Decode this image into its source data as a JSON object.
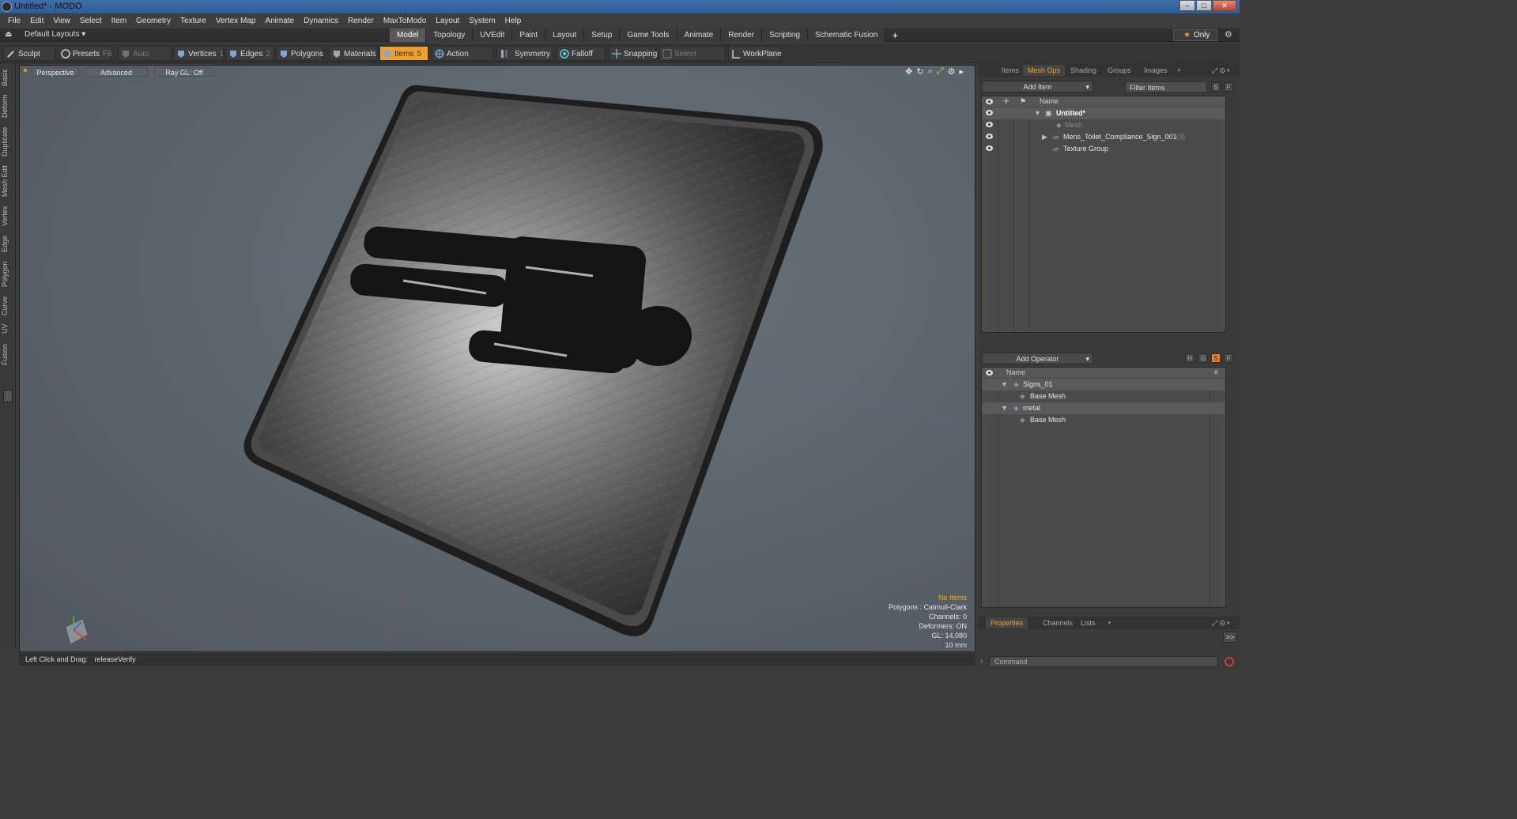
{
  "window": {
    "title": "Untitled* - MODO"
  },
  "menu": [
    "File",
    "Edit",
    "View",
    "Select",
    "Item",
    "Geometry",
    "Texture",
    "Vertex Map",
    "Animate",
    "Dynamics",
    "Render",
    "MaxToModo",
    "Layout",
    "System",
    "Help"
  ],
  "layout": {
    "selector": "Default Layouts ▾",
    "tabs": [
      "Model",
      "Topology",
      "UVEdit",
      "Paint",
      "Layout",
      "Setup",
      "Game Tools",
      "Animate",
      "Render",
      "Scripting",
      "Schematic Fusion"
    ],
    "active_tab": "Model",
    "add": "+",
    "only": "Only"
  },
  "toolbar": {
    "sculpt": "Sculpt",
    "presets": "Presets",
    "presets_key": "F6",
    "auto_select": "Auto Select",
    "vertices": "Vertices",
    "vertices_key": "1",
    "edges": "Edges",
    "edges_key": "2",
    "polygons": "Polygons",
    "materials": "Materials",
    "items": "Items",
    "items_key": "5",
    "action_center": "Action Center",
    "symmetry": "Symmetry",
    "falloff": "Falloff",
    "snapping": "Snapping",
    "select_through": "Select Through",
    "workplane": "WorkPlane"
  },
  "left_tabs": [
    "Basic",
    "Deform",
    "Duplicate",
    "Mesh Edit",
    "Vertex",
    "Edge",
    "Polygon",
    "Curve",
    "UV",
    "Fusion"
  ],
  "viewport": {
    "view": "Perspective",
    "shading": "Advanced",
    "raygl": "Ray GL: Off",
    "hud": {
      "selection": "No Items",
      "polygons": "Polygons : Catmull-Clark",
      "channels": "Channels: 0",
      "deformers": "Deformers: ON",
      "gl": "GL: 14,080",
      "unit": "10 mm"
    }
  },
  "status": {
    "hint": "Left Click and Drag:",
    "action": "releaseVerify"
  },
  "panel": {
    "tabs": [
      "Items",
      "Mesh Ops",
      "Shading",
      "Groups",
      "Images"
    ],
    "active_tab": "Mesh Ops",
    "add_item": "Add Item",
    "filter": "Filter Items",
    "sf": [
      "S",
      "F"
    ],
    "items_header": "Name",
    "items": [
      {
        "name": "Untitled*",
        "count": ""
      },
      {
        "name": "Mesh",
        "count": ""
      },
      {
        "name": "Mens_Toilet_Compliance_Sign_001",
        "count": "(3)"
      },
      {
        "name": "Texture Group",
        "count": ""
      }
    ],
    "add_operator": "Add Operator",
    "hgsf": [
      "H",
      "G",
      "S",
      "F"
    ],
    "ops_header": "Name",
    "ops_hash": "#",
    "ops": [
      {
        "name": "Signs_01"
      },
      {
        "name": "Base Mesh"
      },
      {
        "name": "metal"
      },
      {
        "name": "Base Mesh"
      }
    ],
    "bottom_tabs": [
      "Properties",
      "Channels",
      "Lists"
    ],
    "bottom_active": "Properties",
    "expand": ">>",
    "command_placeholder": "Command"
  },
  "colors": {
    "accent": "#f0a030",
    "viewport_bg": "#5b636b"
  }
}
